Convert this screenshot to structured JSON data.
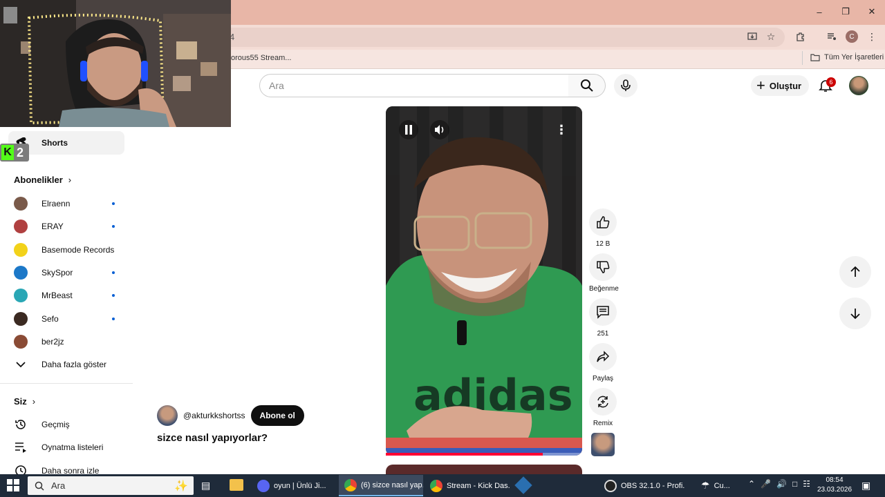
{
  "browser": {
    "url_fragment": "4",
    "bookmark_left": "orous55 Stream...",
    "bookmark_right": "Tüm Yer İşaretleri",
    "profile_initial": "C"
  },
  "youtube": {
    "search_placeholder": "Ara",
    "create_label": "Oluştur",
    "notification_count": "6"
  },
  "sidebar": {
    "shorts_label": "Shorts",
    "subscriptions_title": "Abonelikler",
    "subscriptions": [
      {
        "name": "Elraenn",
        "new": true,
        "color": "#7a5a4a"
      },
      {
        "name": "ERAY",
        "new": true,
        "color": "#b04040"
      },
      {
        "name": "Basemode Records",
        "new": false,
        "color": "#f2d21a"
      },
      {
        "name": "SkySpor",
        "new": true,
        "color": "#1c78c8"
      },
      {
        "name": "MrBeast",
        "new": true,
        "color": "#2aa7b5"
      },
      {
        "name": "Sefo",
        "new": true,
        "color": "#3b2a22"
      },
      {
        "name": "ber2jz",
        "new": false,
        "color": "#8a4b35"
      }
    ],
    "show_more": "Daha fazla göster",
    "you_title": "Siz",
    "you_items": [
      "Geçmiş",
      "Oynatma listeleri",
      "Daha sonra izle"
    ]
  },
  "short": {
    "channel": "@akturkkshortss",
    "subscribe_label": "Abone ol",
    "title": "sizce nasıl yapıyorlar?",
    "likes": "12 B",
    "dislike_label": "Beğenme",
    "comments": "251",
    "share_label": "Paylaş",
    "remix_label": "Remix",
    "progress": 0.8
  },
  "taskbar": {
    "search_placeholder": "Ara",
    "tasks": [
      "oyun | Ünlü Ji...",
      "(6) sizce nasıl yap...",
      "Stream - Kick Das...",
      "OBS 32.1.0 - Profi..."
    ],
    "weather": "Cu...",
    "time": "08:54",
    "date": "23.03.2026"
  }
}
